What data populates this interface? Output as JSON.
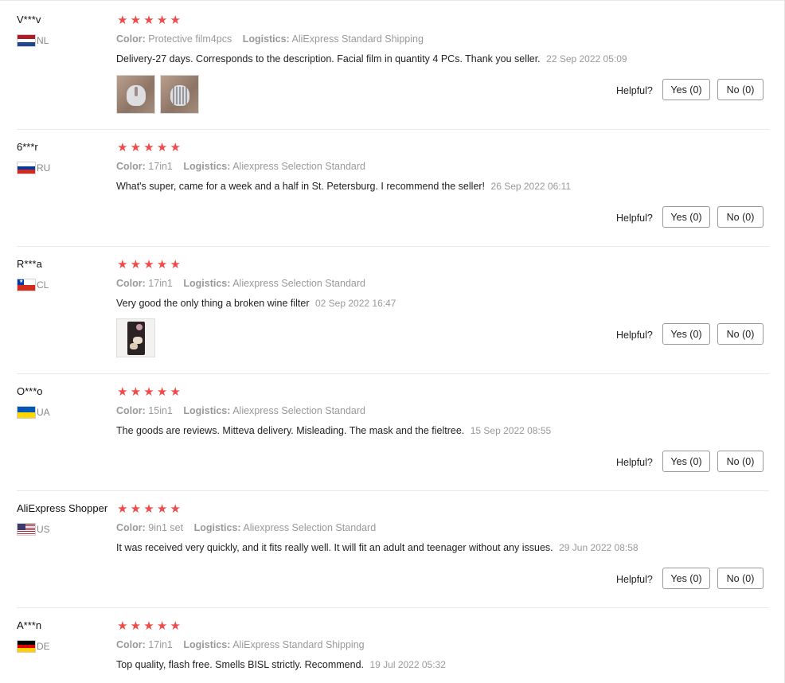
{
  "labels": {
    "color": "Color:",
    "logistics": "Logistics:",
    "helpful": "Helpful?",
    "star": "★"
  },
  "reviews": [
    {
      "user": "V***v",
      "country": "NL",
      "flag": "nl",
      "color_value": "Protective film4pcs",
      "logistics_value": "AliExpress Standard Shipping",
      "text": "Delivery-27 days. Corresponds to the description. Facial film in quantity 4 PCs. Thank you seller.",
      "date": "22 Sep 2022 05:09",
      "rating": 5,
      "images": [
        "film-photo-1",
        "film-photo-2"
      ],
      "yes": "Yes (0)",
      "no": "No (0)"
    },
    {
      "user": "6***r",
      "country": "RU",
      "flag": "ru",
      "color_value": "17in1",
      "logistics_value": "Aliexpress Selection Standard",
      "text": "What's super, came for a week and a half in St. Petersburg. I recommend the seller!",
      "date": "26 Sep 2022 06:11",
      "rating": 5,
      "images": [],
      "yes": "Yes (0)",
      "no": "No (0)"
    },
    {
      "user": "R***a",
      "country": "CL",
      "flag": "cl",
      "color_value": "17in1",
      "logistics_value": "Aliexpress Selection Standard",
      "text": "Very good the only thing a broken wine filter",
      "date": "02 Sep 2022 16:47",
      "rating": 5,
      "images": [
        "filter-photo"
      ],
      "yes": "Yes (0)",
      "no": "No (0)"
    },
    {
      "user": "O***o",
      "country": "UA",
      "flag": "ua",
      "color_value": "15in1",
      "logistics_value": "Aliexpress Selection Standard",
      "text": "The goods are reviews. Mitteva delivery. Misleading. The mask and the fieltree.",
      "date": "15 Sep 2022 08:55",
      "rating": 5,
      "images": [],
      "yes": "Yes (0)",
      "no": "No (0)"
    },
    {
      "user": "AliExpress Shopper",
      "country": "US",
      "flag": "us",
      "color_value": "9in1 set",
      "logistics_value": "Aliexpress Selection Standard",
      "text": "It was received very quickly, and it fits really well. It will fit an adult and teenager without any issues.",
      "date": "29 Jun 2022 08:58",
      "rating": 5,
      "images": [],
      "yes": "Yes (0)",
      "no": "No (0)"
    },
    {
      "user": "A***n",
      "country": "DE",
      "flag": "de",
      "color_value": "17in1",
      "logistics_value": "AliExpress Standard Shipping",
      "text": "Top quality, flash free. Smells BISL strictly. Recommend.",
      "date": "19 Jul 2022 05:32",
      "rating": 5,
      "images": []
    }
  ]
}
